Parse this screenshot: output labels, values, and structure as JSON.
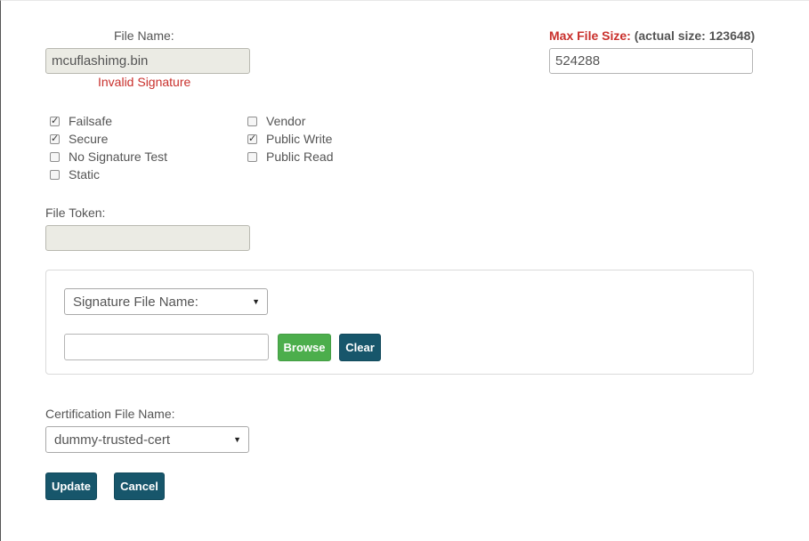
{
  "file_name": {
    "label": "File Name:",
    "value": "mcuflashimg.bin",
    "error": "Invalid Signature"
  },
  "max_size": {
    "label": "Max File Size:",
    "actual": "(actual size: 123648)",
    "value": "524288"
  },
  "flags": {
    "left": [
      {
        "label": "Failsafe",
        "checked": true
      },
      {
        "label": "Secure",
        "checked": true
      },
      {
        "label": "No Signature Test",
        "checked": false
      },
      {
        "label": "Static",
        "checked": false
      }
    ],
    "right": [
      {
        "label": "Vendor",
        "checked": false
      },
      {
        "label": "Public Write",
        "checked": true
      },
      {
        "label": "Public Read",
        "checked": false
      }
    ]
  },
  "file_token": {
    "label": "File Token:",
    "value": ""
  },
  "signature": {
    "select_value": "Signature File Name:",
    "path_value": "",
    "browse_label": "Browse",
    "clear_label": "Clear"
  },
  "certification": {
    "label": "Certification File Name:",
    "value": "dummy-trusted-cert"
  },
  "actions": {
    "update_label": "Update",
    "cancel_label": "Cancel"
  },
  "colors": {
    "error": "#c9302c",
    "browse": "#4cae4c",
    "dark_button": "#17566b"
  }
}
